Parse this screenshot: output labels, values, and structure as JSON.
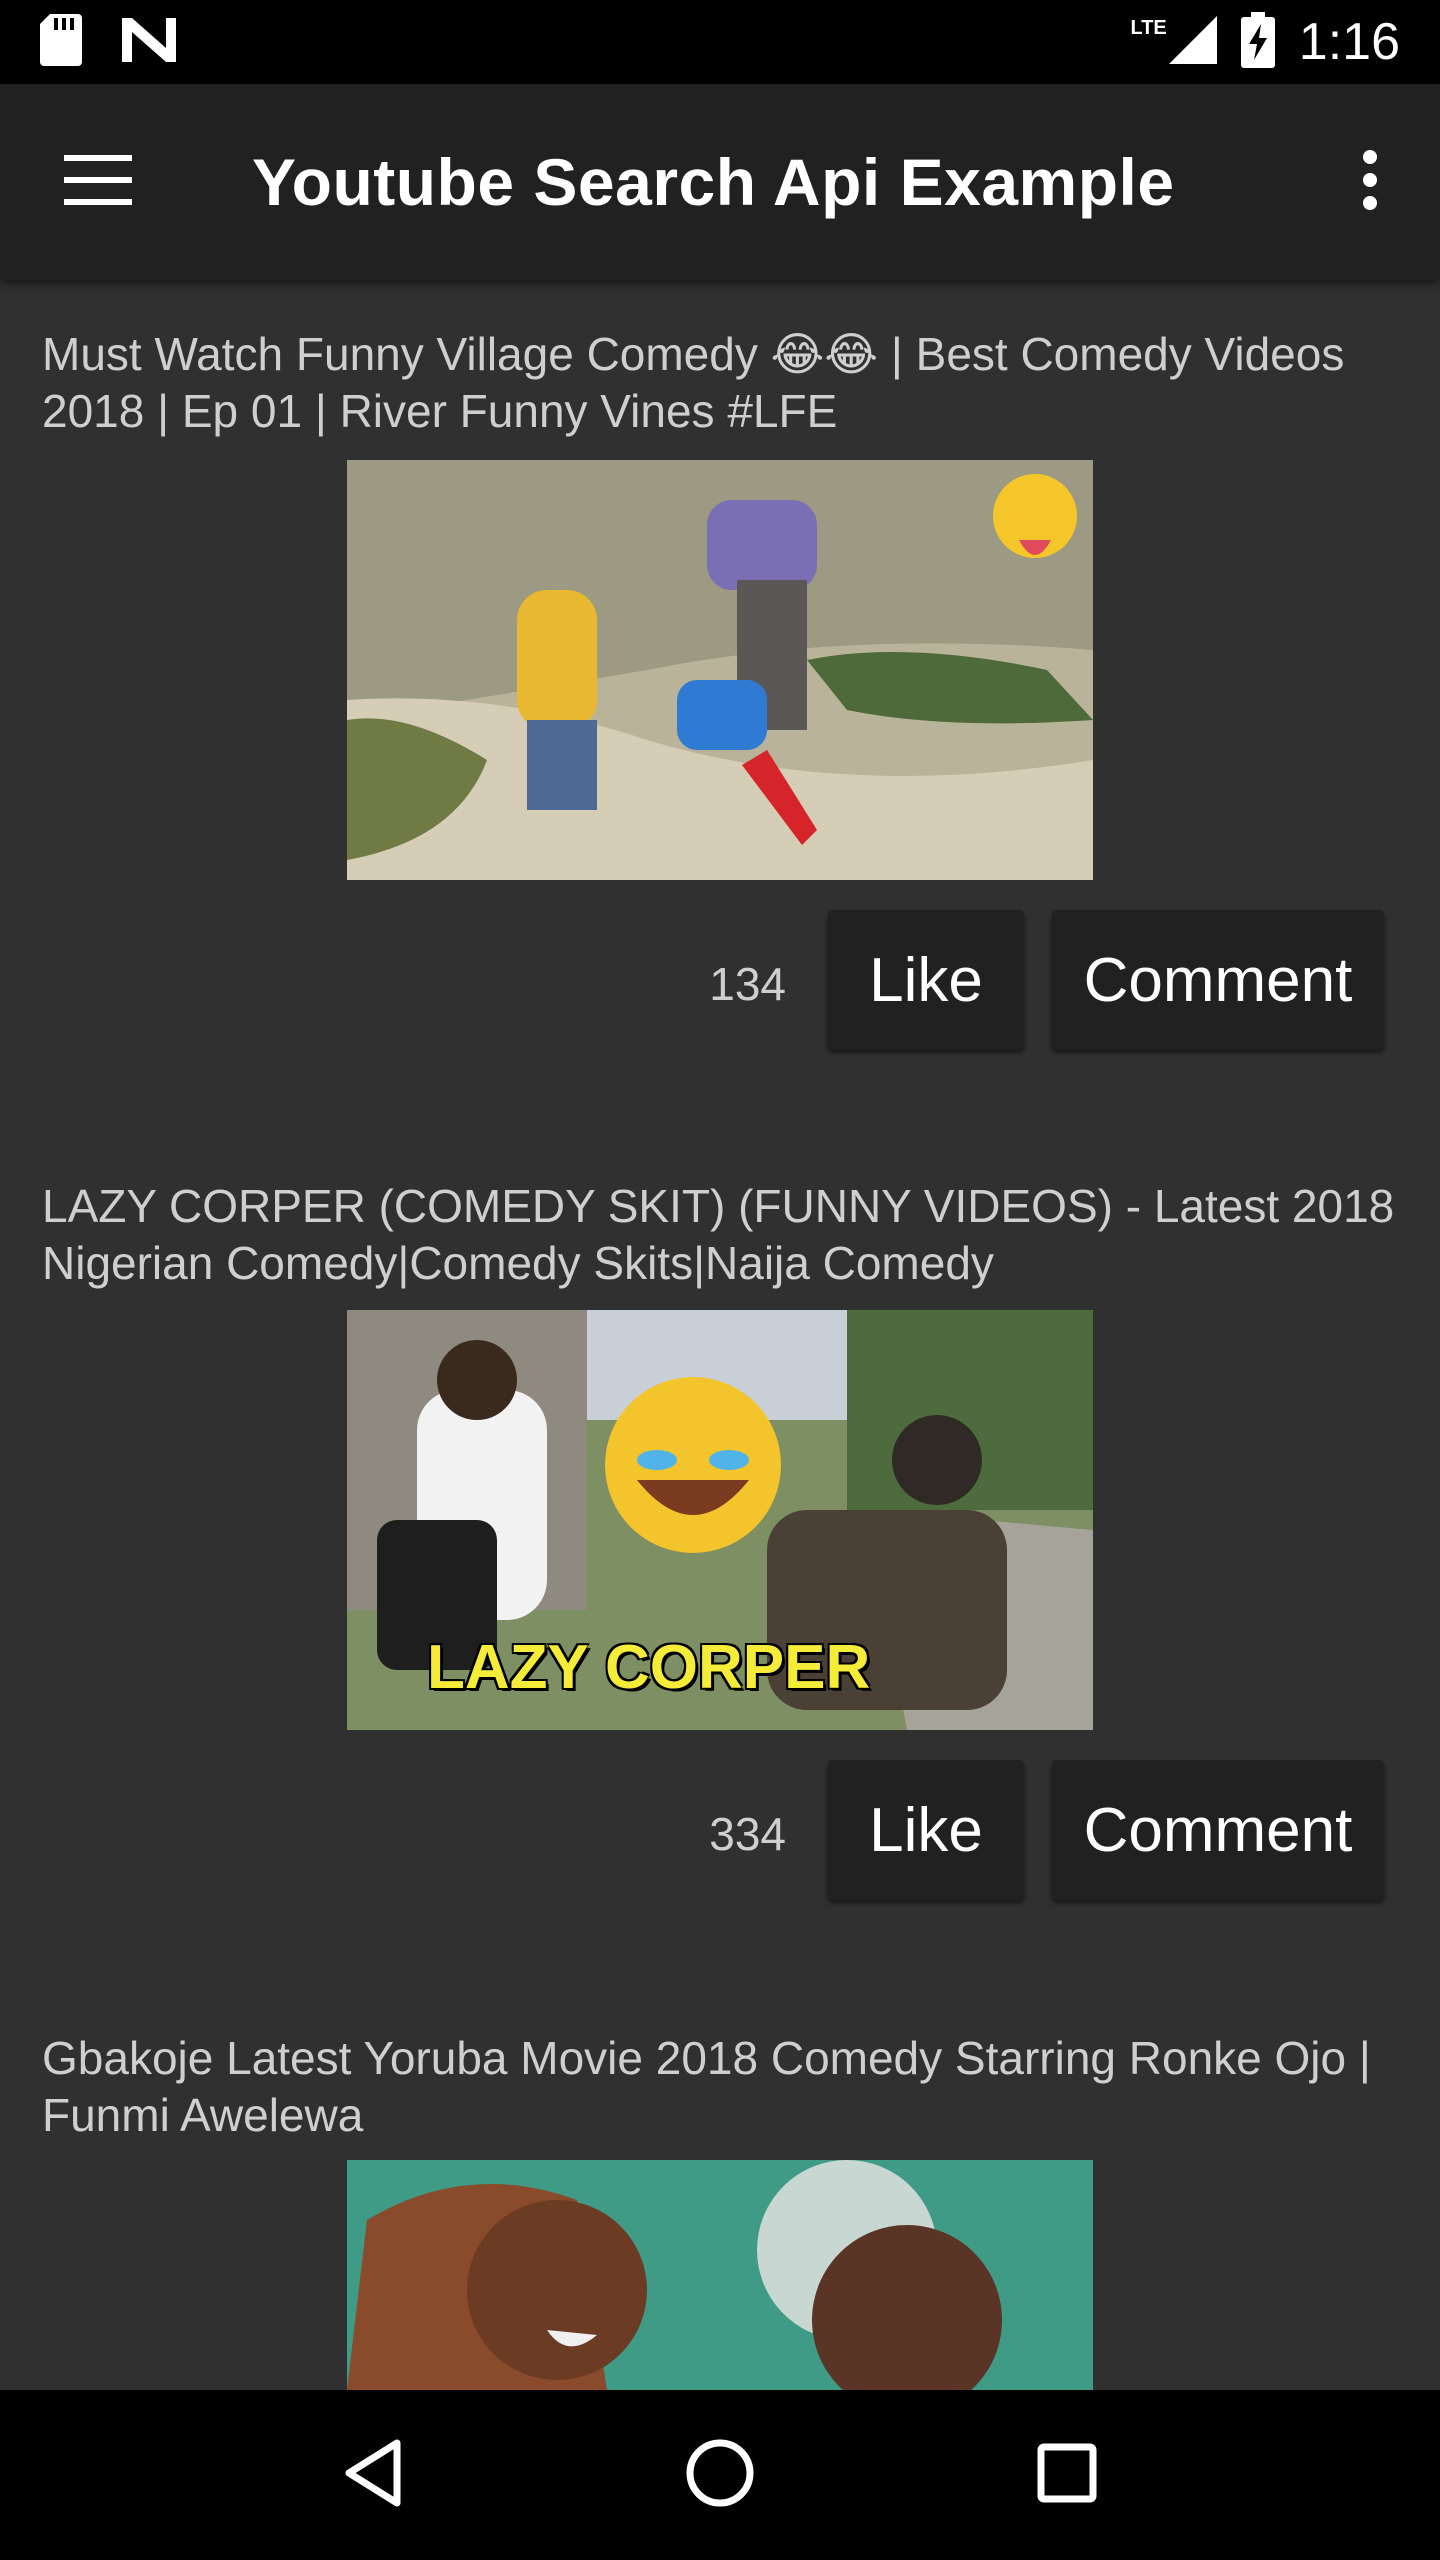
{
  "status_bar": {
    "time": "1:16",
    "network": "LTE",
    "left_icons": [
      "sd-card-icon",
      "n-logo-icon"
    ],
    "right_icons": [
      "signal-icon",
      "battery-charging-icon"
    ]
  },
  "app_bar": {
    "title": "Youtube Search Api Example",
    "menu_icon": "hamburger-menu-icon",
    "overflow_icon": "more-vert-icon"
  },
  "videos": [
    {
      "title": "Must Watch Funny Village Comedy 😂😂 | Best Comedy Videos 2018 | Ep 01 | River Funny Vines #LFE",
      "count": "134",
      "like_label": "Like",
      "comment_label": "Comment"
    },
    {
      "title": "LAZY CORPER (COMEDY SKIT) (FUNNY VIDEOS) - Latest 2018 Nigerian Comedy|Comedy Skits|Naija Comedy",
      "thumb_text": "LAZY CORPER",
      "count": "334",
      "like_label": "Like",
      "comment_label": "Comment"
    },
    {
      "title": "Gbakoje Latest Yoruba Movie 2018 Comedy Starring Ronke Ojo | Funmi Awelewa"
    }
  ],
  "nav_bar": {
    "back_icon": "back-triangle-icon",
    "home_icon": "home-circle-icon",
    "recents_icon": "recents-square-icon"
  }
}
